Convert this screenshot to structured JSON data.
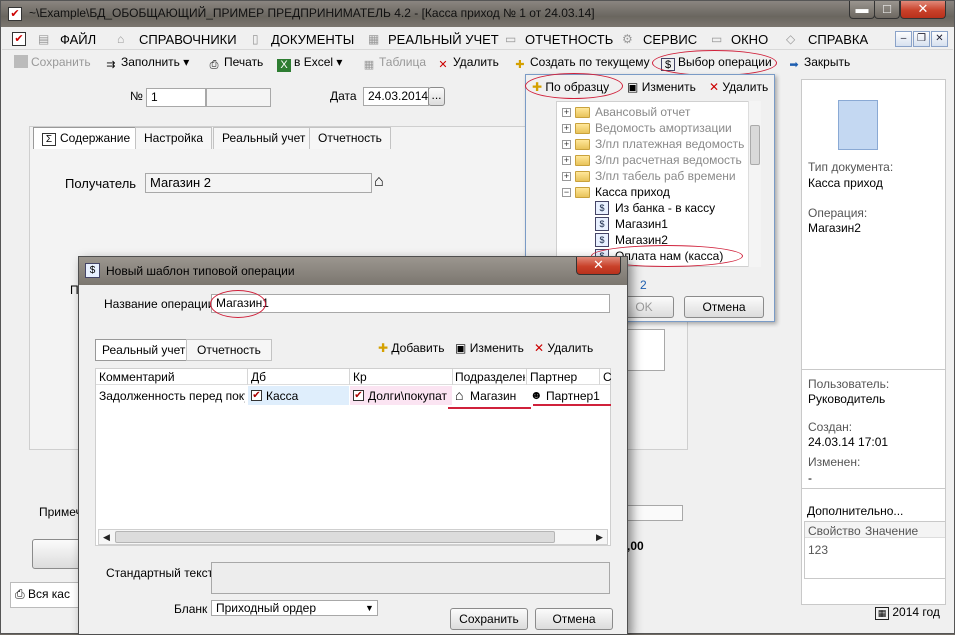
{
  "window": {
    "title": "~\\Example\\БД_ОБОБЩАЮЩИЙ_ПРИМЕР  ПРЕДПРИНИМАТЕЛЬ 4.2 - [Касса приход № 1 от 24.03.14]",
    "min": "▬",
    "max": "□",
    "close": "✕"
  },
  "menu": [
    "ФАЙЛ",
    "СПРАВОЧНИКИ",
    "ДОКУМЕНТЫ",
    "РЕАЛЬНЫЙ УЧЕТ",
    "ОТЧЕТНОСТЬ",
    "СЕРВИС",
    "ОКНО",
    "СПРАВКА"
  ],
  "mdi": [
    "–",
    "❐",
    "✕"
  ],
  "toolbar": {
    "save": "Сохранить",
    "fill": "Заполнить",
    "print": "Печать",
    "excel": "в Excel",
    "table": "Таблица",
    "delete": "Удалить",
    "create_current": "Создать по текущему",
    "select_op": "Выбор операции",
    "close": "Закрыть"
  },
  "doc": {
    "number_label": "№",
    "number": "1",
    "date_label": "Дата",
    "date": "24.03.2014",
    "date_btn": "...",
    "tabs": [
      "Содержание",
      "Настройка",
      "Реальный учет",
      "Отчетность"
    ],
    "recipient_label": "Получатель",
    "recipient": "Магазин 2",
    "note_label_partial": "Примеч",
    "all_cash_partial": "Вся кас",
    "partial_p": "П",
    "partial_amount": ",00"
  },
  "popup": {
    "by_template": "По образцу",
    "edit": "Изменить",
    "delete": "Удалить",
    "tree": [
      {
        "label": "Авансовый отчет",
        "type": "folder",
        "muted": true
      },
      {
        "label": "Ведомость амортизации",
        "type": "folder",
        "muted": true
      },
      {
        "label": "З/пл платежная ведомость",
        "type": "folder",
        "muted": true
      },
      {
        "label": "З/пл расчетная ведомость",
        "type": "folder",
        "muted": true
      },
      {
        "label": "З/пл табель раб времени",
        "type": "folder",
        "muted": true
      },
      {
        "label": "Касса приход",
        "type": "folder-open",
        "muted": false
      },
      {
        "label": "Из банка - в кассу",
        "type": "op",
        "muted": false
      },
      {
        "label": "Магазин1",
        "type": "op",
        "muted": false
      },
      {
        "label": "Магазин2",
        "type": "op",
        "muted": false
      },
      {
        "label": "Оплата нам (касса)",
        "type": "op",
        "muted": false
      }
    ],
    "ok": "OK",
    "cancel": "Отмена",
    "fragment": "2"
  },
  "right_panel": {
    "doc_type_label": "Тип документа:",
    "doc_type": "Касса приход",
    "operation_label": "Операция:",
    "operation": "Магазин2",
    "user_label": "Пользователь:",
    "user": "Руководитель",
    "created_label": "Создан:",
    "created": "24.03.14  17:01",
    "modified_label": "Изменен:",
    "modified": "-",
    "more": "Дополнительно...",
    "prop_col": "Свойство",
    "value_col": "Значение",
    "prop_val": "123"
  },
  "dialog": {
    "title": "Новый шаблон типовой операции",
    "op_name_label": "Название операции",
    "op_name": "Магазин1",
    "tabs": [
      "Реальный учет",
      "Отчетность"
    ],
    "add": "Добавить",
    "edit": "Изменить",
    "delete": "Удалить",
    "columns": [
      "Комментарий",
      "Дб",
      "Кр",
      "Подразделен",
      "Партнер",
      "С"
    ],
    "row": {
      "comment": "Задолженность перед поку",
      "db": "Касса",
      "kr": "Долги\\покупат",
      "dept": "Магазин",
      "partner": "Партнер1"
    },
    "std_text_label": "Стандартный текст",
    "blank_label": "Бланк",
    "blank_value": "Приходный ордер",
    "save": "Сохранить",
    "cancel": "Отмена"
  },
  "status": {
    "year": "2014 год"
  },
  "colors": {
    "annotation": "#d0213b",
    "accent_blue": "#3b6fc4"
  }
}
